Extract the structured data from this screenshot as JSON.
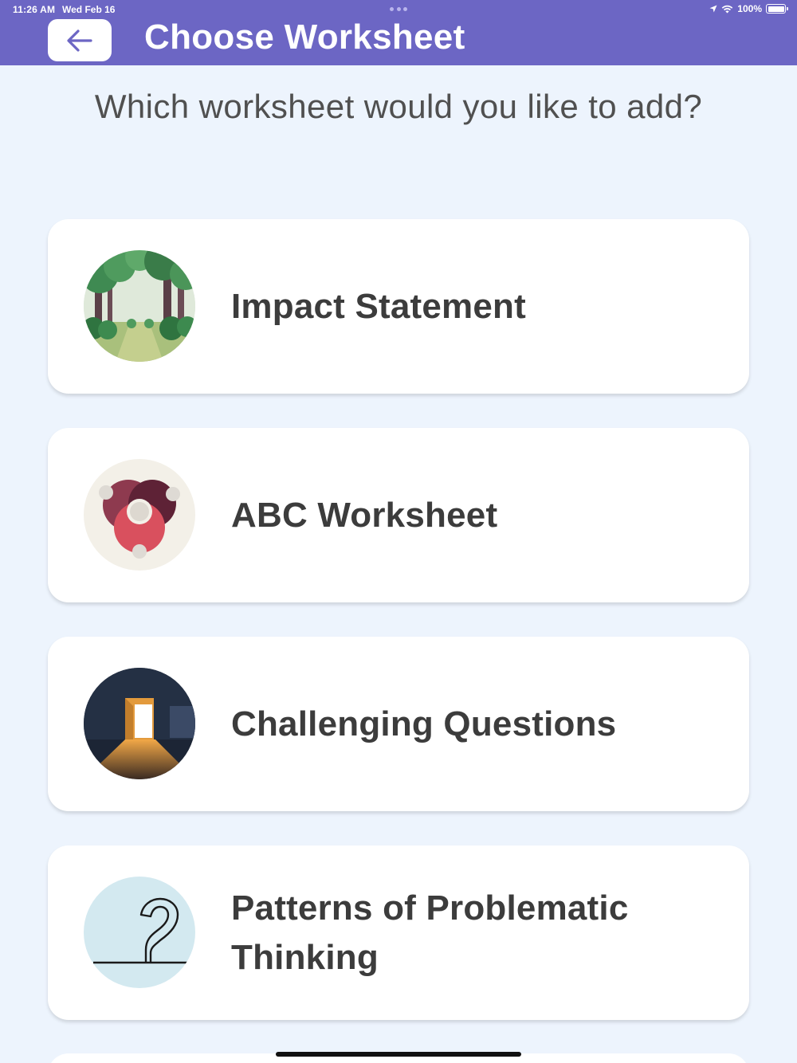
{
  "status_bar": {
    "time": "11:26 AM",
    "date": "Wed Feb 16",
    "battery": "100%"
  },
  "header": {
    "title": "Choose Worksheet",
    "back_icon": "arrow-left-icon",
    "background": "#6c66c4"
  },
  "prompt": "Which worksheet would you like to add?",
  "worksheets": [
    {
      "label": "Impact Statement",
      "icon": "forest-path-icon"
    },
    {
      "label": "ABC Worksheet",
      "icon": "interlocking-circles-icon"
    },
    {
      "label": "Challenging Questions",
      "icon": "open-door-icon"
    },
    {
      "label": "Patterns of Problematic Thinking",
      "icon": "question-mark-icon"
    }
  ]
}
